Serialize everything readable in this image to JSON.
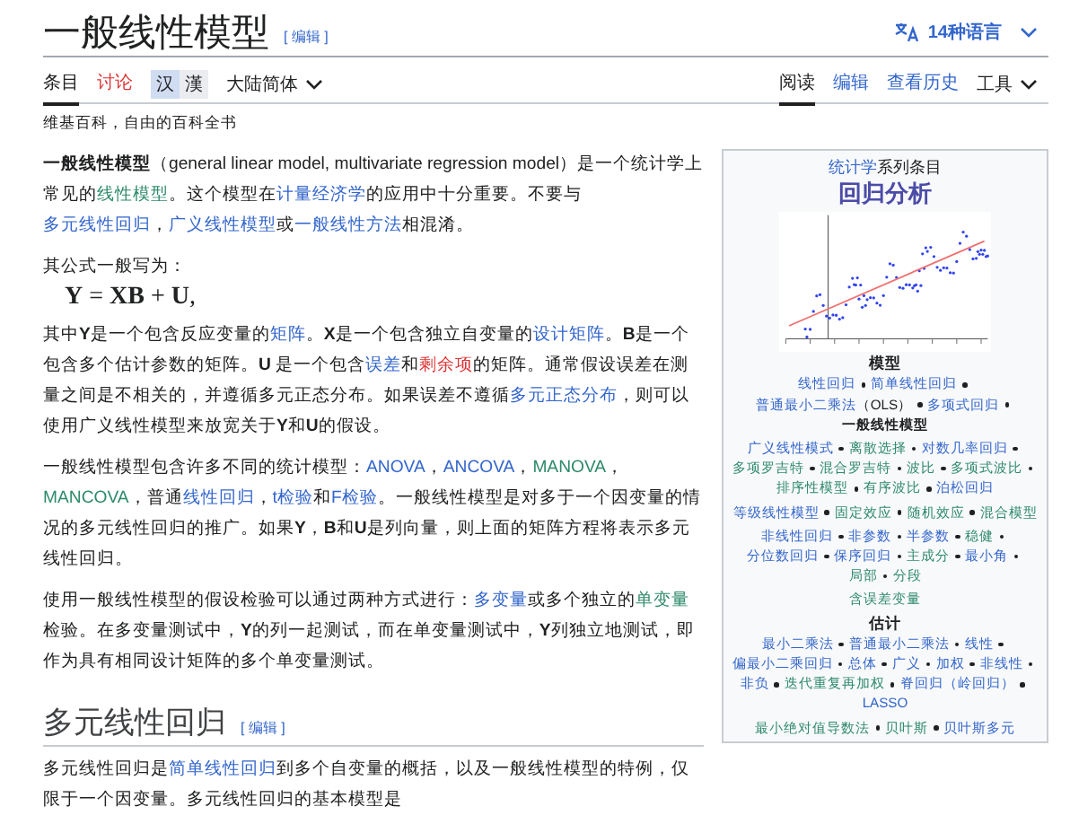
{
  "title": "一般线性模型",
  "title_edit": "[ 编辑 ]",
  "languages": "14种语言",
  "namespace_tabs": [
    {
      "label": "条目",
      "selected": true,
      "kind": "link"
    },
    {
      "label": "讨论",
      "selected": false,
      "kind": "new"
    }
  ],
  "variant_toggle": [
    {
      "label": "汉",
      "selected": true
    },
    {
      "label": "漢",
      "selected": false
    }
  ],
  "variant_menu": "大陆简体",
  "view_tabs": [
    {
      "label": "阅读",
      "selected": true
    },
    {
      "label": "编辑",
      "selected": false
    },
    {
      "label": "查看历史",
      "selected": false
    }
  ],
  "tools_menu": "工具",
  "tagline": "维基百科，自由的百科全书",
  "content": [
    {
      "kind": "text",
      "segments": [
        {
          "kind": "text",
          "text": "**一般线性模型**（general linear model, multivariate regression model）是一个统计学上常见的"
        },
        {
          "kind": "visited",
          "text": "线性模型"
        },
        {
          "kind": "text",
          "text": "。这个模型在"
        },
        {
          "kind": "link",
          "text": "计量经济学"
        },
        {
          "kind": "text",
          "text": "的应用中十分重要。不要与"
        },
        {
          "kind": "link",
          "text": "多元线性回归"
        },
        {
          "kind": "text",
          "text": "，"
        },
        {
          "kind": "link",
          "text": "广义线性模型"
        },
        {
          "kind": "text",
          "text": "或"
        },
        {
          "kind": "link",
          "text": "一般线性方法"
        },
        {
          "kind": "text",
          "text": "相混淆。"
        }
      ]
    },
    {
      "kind": "text",
      "segments": [
        {
          "kind": "text",
          "text": "其公式一般写为："
        }
      ]
    },
    {
      "kind": "formula",
      "text": "**Y** = **XB** + **U**,"
    },
    {
      "kind": "text",
      "segments": [
        {
          "kind": "text",
          "text": "其中**Y**是一个包含反应变量的"
        },
        {
          "kind": "link",
          "text": "矩阵"
        },
        {
          "kind": "text",
          "text": "。**X**是一个包含独立自变量的"
        },
        {
          "kind": "link",
          "text": "设计矩阵"
        },
        {
          "kind": "text",
          "text": "。**B**是一个包含多个估计参数的矩阵。**U** 是一个包含"
        },
        {
          "kind": "link",
          "text": "误差"
        },
        {
          "kind": "text",
          "text": "和"
        },
        {
          "kind": "new",
          "text": "剩余项"
        },
        {
          "kind": "text",
          "text": "的矩阵。通常假设误差在测量之间是不相关的，并遵循多元正态分布。如果误差不遵循"
        },
        {
          "kind": "link",
          "text": "多元正态分布"
        },
        {
          "kind": "text",
          "text": "，则可以使用广义线性模型来放宽关于**Y**和**U**的假设。"
        }
      ]
    },
    {
      "kind": "text",
      "segments": [
        {
          "kind": "text",
          "text": "一般线性模型包含许多不同的统计模型："
        },
        {
          "kind": "link",
          "text": "ANOVA"
        },
        {
          "kind": "text",
          "text": "，"
        },
        {
          "kind": "link",
          "text": "ANCOVA"
        },
        {
          "kind": "text",
          "text": "，"
        },
        {
          "kind": "visited",
          "text": "MANOVA"
        },
        {
          "kind": "text",
          "text": "，"
        },
        {
          "kind": "visited",
          "text": "MANCOVA"
        },
        {
          "kind": "text",
          "text": "，普通"
        },
        {
          "kind": "link",
          "text": "线性回归"
        },
        {
          "kind": "text",
          "text": "，"
        },
        {
          "kind": "link",
          "text": "t检验"
        },
        {
          "kind": "text",
          "text": "和"
        },
        {
          "kind": "link",
          "text": "F检验"
        },
        {
          "kind": "text",
          "text": "。一般线性模型是对多于一个因变量的情况的多元线性回归的推广。如果**Y**，**B**和**U**是列向量，则上面的矩阵方程将表示多元线性回归。"
        }
      ]
    },
    {
      "kind": "text",
      "segments": [
        {
          "kind": "text",
          "text": "使用一般线性模型的假设检验可以通过两种方式进行："
        },
        {
          "kind": "link",
          "text": "多变量"
        },
        {
          "kind": "text",
          "text": "或多个独立的"
        },
        {
          "kind": "visited",
          "text": "单变量"
        },
        {
          "kind": "text",
          "text": "检验。在多变量测试中，**Y**的列一起测试，而在单变量测试中，**Y**列独立地测试，即作为具有相同设计矩阵的多个单变量测试。"
        }
      ]
    },
    {
      "kind": "heading",
      "text": "多元线性回归",
      "edit": "[ 编辑 ]"
    },
    {
      "kind": "text",
      "segments": [
        {
          "kind": "text",
          "text": "多元线性回归是"
        },
        {
          "kind": "link",
          "text": "简单线性回归"
        },
        {
          "kind": "text",
          "text": "到多个自变量的概括，以及一般线性模型的特例，仅限于一个因变量。多元线性回归的基本模型是"
        }
      ]
    }
  ],
  "infobox": {
    "series_link": "统计学",
    "series_text": "系列条目",
    "title": "回归分析",
    "sections": [
      {
        "heading": "模型",
        "groups": [
          [
            {
              "text": "线性回归",
              "kind": "link"
            },
            {
              "text": "简单线性回归",
              "kind": "link"
            },
            {
              "text": "普通最小二乘法",
              "kind": "link",
              "note": "（OLS）"
            },
            {
              "text": "多项式回归",
              "kind": "link"
            },
            {
              "text": "一般线性模型",
              "kind": "current"
            }
          ],
          [
            {
              "text": "广义线性模式",
              "kind": "link"
            },
            {
              "text": "离散选择",
              "kind": "visited"
            },
            {
              "text": "对数几率回归",
              "kind": "link"
            },
            {
              "text": "多项罗吉特",
              "kind": "visited"
            },
            {
              "text": "混合罗吉特",
              "kind": "visited"
            },
            {
              "text": "波比",
              "kind": "visited"
            },
            {
              "text": "多项式波比",
              "kind": "visited"
            },
            {
              "text": "排序性模型",
              "kind": "visited"
            },
            {
              "text": "有序波比",
              "kind": "visited"
            },
            {
              "text": "泊松回归",
              "kind": "link"
            }
          ],
          [
            {
              "text": "等级线性模型",
              "kind": "link"
            },
            {
              "text": "固定效应",
              "kind": "visited"
            },
            {
              "text": "随机效应",
              "kind": "visited"
            },
            {
              "text": "混合模型",
              "kind": "visited"
            }
          ],
          [
            {
              "text": "非线性回归",
              "kind": "link"
            },
            {
              "text": "非参数",
              "kind": "link"
            },
            {
              "text": "半参数",
              "kind": "link"
            },
            {
              "text": "稳健",
              "kind": "visited"
            },
            {
              "text": "分位数回归",
              "kind": "link"
            },
            {
              "text": "保序回归",
              "kind": "link"
            },
            {
              "text": "主成分",
              "kind": "visited"
            },
            {
              "text": "最小角",
              "kind": "link"
            },
            {
              "text": "局部",
              "kind": "visited"
            },
            {
              "text": "分段",
              "kind": "visited"
            }
          ],
          [
            {
              "text": "含误差变量",
              "kind": "visited"
            }
          ]
        ]
      },
      {
        "heading": "估计",
        "groups": [
          [
            {
              "text": "最小二乘法",
              "kind": "link"
            },
            {
              "text": "普通最小二乘法",
              "kind": "link"
            },
            {
              "text": "线性",
              "kind": "link"
            },
            {
              "text": "偏最小二乘回归",
              "kind": "link"
            },
            {
              "text": "总体",
              "kind": "link"
            },
            {
              "text": "广义",
              "kind": "link"
            },
            {
              "text": "加权",
              "kind": "link"
            },
            {
              "text": "非线性",
              "kind": "link"
            },
            {
              "text": "非负",
              "kind": "link"
            },
            {
              "text": "迭代重复再加权",
              "kind": "visited"
            },
            {
              "text": "脊回归（岭回归）",
              "kind": "link"
            },
            {
              "text": "LASSO",
              "kind": "link"
            }
          ],
          [
            {
              "text": "最小绝对值导数法",
              "kind": "visited"
            },
            {
              "text": "贝叶斯",
              "kind": "visited"
            },
            {
              "text": "贝叶斯多元",
              "kind": "link"
            }
          ]
        ]
      }
    ]
  }
}
